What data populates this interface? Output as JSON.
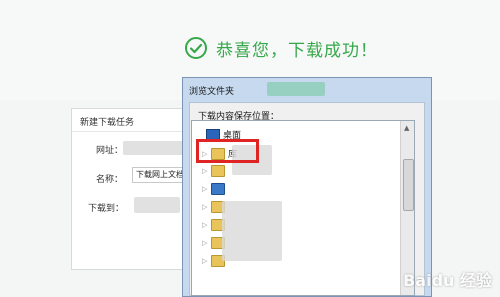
{
  "success": {
    "message": "恭喜您，下载成功！",
    "icon": "check-circle-icon",
    "color": "#36a84a"
  },
  "new_task_dialog": {
    "title": "新建下载任务",
    "url_label": "网址：",
    "name_label": "名称：",
    "name_value": "下载网上文档",
    "save_to_label": "下载到："
  },
  "browse_dialog": {
    "title": "浏览文件夹",
    "prompt": "下载内容保存位置：",
    "items": [
      {
        "label": "桌面",
        "icon": "desktop-icon",
        "selected": true
      },
      {
        "label": "库",
        "icon": "folder-icon"
      }
    ]
  },
  "watermark": "Baidu 经验",
  "colors": {
    "highlight": "#e02424",
    "folder": "#e8c45a"
  }
}
